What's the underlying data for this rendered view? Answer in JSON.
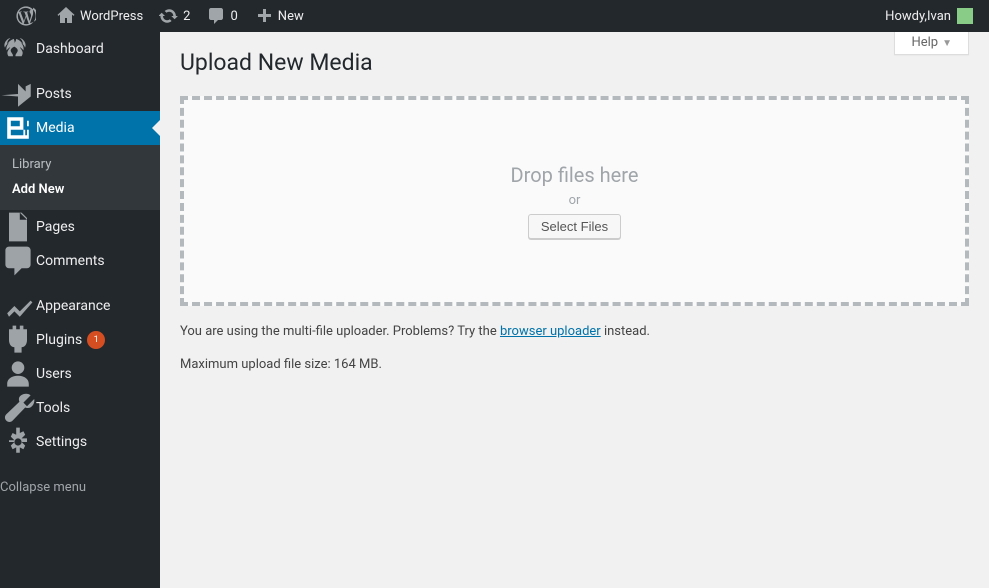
{
  "adminbar": {
    "site_name": "WordPress",
    "updates_count": "2",
    "comments_count": "0",
    "new_label": "New",
    "howdy_prefix": "Howdy, ",
    "user_name": "Ivan"
  },
  "sidebar": {
    "dashboard": "Dashboard",
    "posts": "Posts",
    "media": "Media",
    "media_sub": {
      "library": "Library",
      "add_new": "Add New"
    },
    "pages": "Pages",
    "comments": "Comments",
    "appearance": "Appearance",
    "plugins": "Plugins",
    "plugins_badge": "1",
    "users": "Users",
    "tools": "Tools",
    "settings": "Settings",
    "collapse": "Collapse menu"
  },
  "screen": {
    "help_label": "Help",
    "page_title": "Upload New Media",
    "drop_msg": "Drop files here",
    "or": "or",
    "select_files": "Select Files",
    "info_pre": "You are using the multi-file uploader. Problems? Try the ",
    "info_link": "browser uploader",
    "info_post": " instead.",
    "max_size": "Maximum upload file size: 164 MB."
  }
}
